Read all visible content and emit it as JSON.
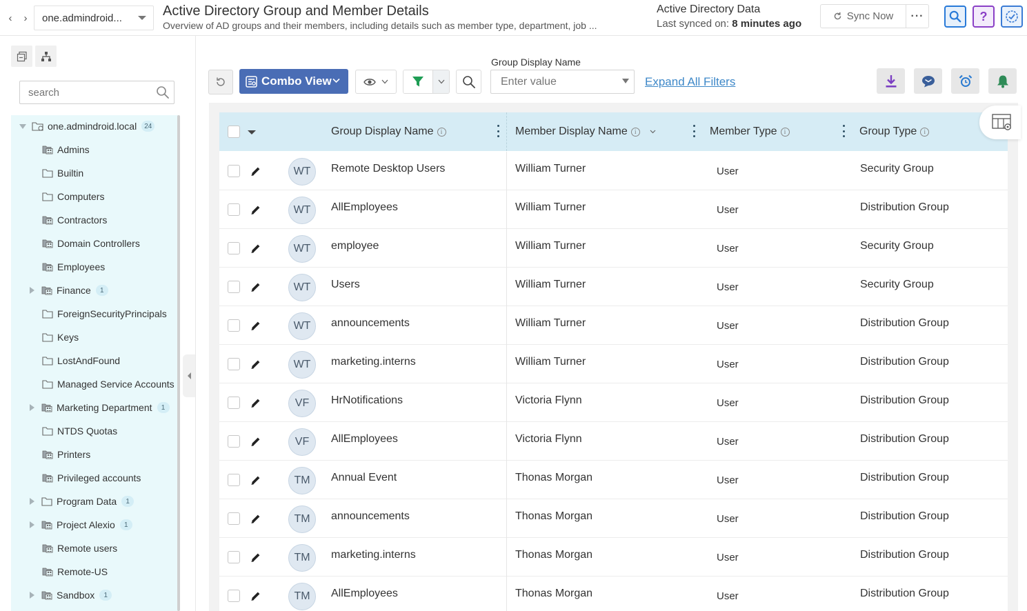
{
  "header": {
    "domain": "one.admindroid...",
    "title": "Active Directory Group and Member Details",
    "subtitle": "Overview of AD groups and their members, including details such as member type, department, job ...",
    "sync_title": "Active Directory Data",
    "sync_label": "Last synced on:",
    "sync_value": "8 minutes ago",
    "sync_button": "Sync Now",
    "more_button": "···",
    "help_icon": "?"
  },
  "sidebar": {
    "search_placeholder": "search",
    "root": {
      "label": "one.admindroid.local",
      "count": "24"
    },
    "items": [
      {
        "label": "Admins",
        "icon": "group-container-icon",
        "expandable": false,
        "count": ""
      },
      {
        "label": "Builtin",
        "icon": "folder-icon",
        "expandable": false,
        "count": ""
      },
      {
        "label": "Computers",
        "icon": "folder-icon",
        "expandable": false,
        "count": ""
      },
      {
        "label": "Contractors",
        "icon": "group-container-icon",
        "expandable": false,
        "count": ""
      },
      {
        "label": "Domain Controllers",
        "icon": "group-container-icon",
        "expandable": false,
        "count": ""
      },
      {
        "label": "Employees",
        "icon": "group-container-icon",
        "expandable": false,
        "count": ""
      },
      {
        "label": "Finance",
        "icon": "group-container-icon",
        "expandable": true,
        "count": "1"
      },
      {
        "label": "ForeignSecurityPrincipals",
        "icon": "folder-icon",
        "expandable": false,
        "count": ""
      },
      {
        "label": "Keys",
        "icon": "folder-icon",
        "expandable": false,
        "count": ""
      },
      {
        "label": "LostAndFound",
        "icon": "folder-icon",
        "expandable": false,
        "count": ""
      },
      {
        "label": "Managed Service Accounts",
        "icon": "folder-icon",
        "expandable": false,
        "count": ""
      },
      {
        "label": "Marketing Department",
        "icon": "group-container-icon",
        "expandable": true,
        "count": "1"
      },
      {
        "label": "NTDS Quotas",
        "icon": "folder-icon",
        "expandable": false,
        "count": ""
      },
      {
        "label": "Printers",
        "icon": "group-container-icon",
        "expandable": false,
        "count": ""
      },
      {
        "label": "Privileged accounts",
        "icon": "group-container-icon",
        "expandable": false,
        "count": ""
      },
      {
        "label": "Program Data",
        "icon": "folder-icon",
        "expandable": true,
        "count": "1"
      },
      {
        "label": "Project Alexio",
        "icon": "group-container-icon",
        "expandable": true,
        "count": "1"
      },
      {
        "label": "Remote users",
        "icon": "group-container-icon",
        "expandable": false,
        "count": ""
      },
      {
        "label": "Remote-US",
        "icon": "group-container-icon",
        "expandable": false,
        "count": ""
      },
      {
        "label": "Sandbox",
        "icon": "group-container-icon",
        "expandable": true,
        "count": "1"
      }
    ]
  },
  "toolbar": {
    "combo_view": "Combo View",
    "filter_label": "Group Display Name",
    "filter_placeholder": "Enter value",
    "expand_filters": "Expand All Filters"
  },
  "table": {
    "columns": [
      "Group Display Name",
      "Member Display Name",
      "Member Type",
      "Group Type"
    ],
    "rows": [
      {
        "initials": "WT",
        "group": "Remote Desktop Users",
        "member": "William Turner",
        "mtype": "User",
        "gtype": "Security Group"
      },
      {
        "initials": "WT",
        "group": "AllEmployees",
        "member": "William Turner",
        "mtype": "User",
        "gtype": "Distribution Group"
      },
      {
        "initials": "WT",
        "group": "employee",
        "member": "William Turner",
        "mtype": "User",
        "gtype": "Security Group"
      },
      {
        "initials": "WT",
        "group": "Users",
        "member": "William Turner",
        "mtype": "User",
        "gtype": "Security Group"
      },
      {
        "initials": "WT",
        "group": "announcements",
        "member": "William Turner",
        "mtype": "User",
        "gtype": "Distribution Group"
      },
      {
        "initials": "WT",
        "group": "marketing.interns",
        "member": "William Turner",
        "mtype": "User",
        "gtype": "Distribution Group"
      },
      {
        "initials": "VF",
        "group": "HrNotifications",
        "member": "Victoria Flynn",
        "mtype": "User",
        "gtype": "Distribution Group"
      },
      {
        "initials": "VF",
        "group": "AllEmployees",
        "member": "Victoria Flynn",
        "mtype": "User",
        "gtype": "Distribution Group"
      },
      {
        "initials": "TM",
        "group": "Annual Event",
        "member": "Thonas Morgan",
        "mtype": "User",
        "gtype": "Distribution Group"
      },
      {
        "initials": "TM",
        "group": "announcements",
        "member": "Thonas Morgan",
        "mtype": "User",
        "gtype": "Distribution Group"
      },
      {
        "initials": "TM",
        "group": "marketing.interns",
        "member": "Thonas Morgan",
        "mtype": "User",
        "gtype": "Distribution Group"
      },
      {
        "initials": "TM",
        "group": "AllEmployees",
        "member": "Thonas Morgan",
        "mtype": "User",
        "gtype": "Distribution Group"
      }
    ]
  },
  "colors": {
    "accent": "#4a6db5",
    "tree_bg": "#e9f9fb",
    "header_bg": "#d6ecf5",
    "link": "#3e88c8",
    "download": "#7b3fc2",
    "chat": "#3a5f9a",
    "alarm": "#2a7bd1",
    "bell": "#2e8b57"
  }
}
